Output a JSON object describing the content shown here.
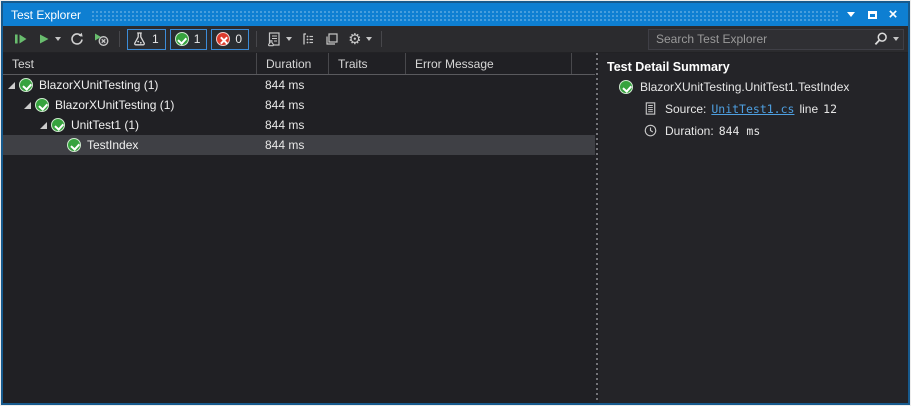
{
  "window": {
    "title": "Test Explorer"
  },
  "toolbar": {
    "total_count": "1",
    "passed_count": "1",
    "failed_count": "0",
    "search_placeholder": "Search Test Explorer"
  },
  "columns": {
    "test": "Test",
    "duration": "Duration",
    "traits": "Traits",
    "error": "Error Message"
  },
  "tree": {
    "rows": [
      {
        "label": "BlazorXUnitTesting (1)",
        "duration": "844 ms",
        "level": 0,
        "expanded": true,
        "selected": false
      },
      {
        "label": "BlazorXUnitTesting (1)",
        "duration": "844 ms",
        "level": 1,
        "expanded": true,
        "selected": false
      },
      {
        "label": "UnitTest1 (1)",
        "duration": "844 ms",
        "level": 2,
        "expanded": true,
        "selected": false
      },
      {
        "label": "TestIndex",
        "duration": "844 ms",
        "level": 3,
        "expanded": false,
        "selected": true
      }
    ]
  },
  "detail": {
    "heading": "Test Detail Summary",
    "test_name": "BlazorXUnitTesting.UnitTest1.TestIndex",
    "source_label": "Source:",
    "source_link": "UnitTest1.cs",
    "line_label": "line",
    "line_number": "12",
    "duration_label": "Duration:",
    "duration_value": "844 ms"
  },
  "colors": {
    "titlebar": "#0e7fd2",
    "accent_border": "#175a8d",
    "passed_green": "#36a33e",
    "failed_red": "#dd3a2c",
    "filter_border": "#3c8cd8",
    "link_blue": "#4e9fe0",
    "selected_row": "#3f4045"
  }
}
